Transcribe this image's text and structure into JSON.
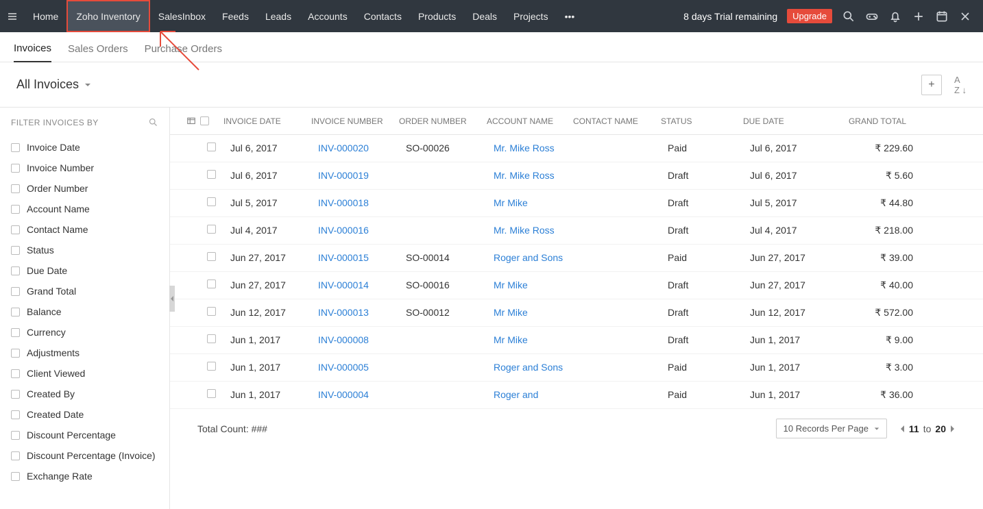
{
  "nav": {
    "items": [
      "Home",
      "Zoho Inventory",
      "SalesInbox",
      "Feeds",
      "Leads",
      "Accounts",
      "Contacts",
      "Products",
      "Deals",
      "Projects"
    ],
    "active_index": 1
  },
  "trial": {
    "text": "8 days Trial remaining",
    "upgrade": "Upgrade"
  },
  "subtabs": {
    "items": [
      "Invoices",
      "Sales Orders",
      "Purchase Orders"
    ],
    "active_index": 0
  },
  "title": "All Invoices",
  "sidebar": {
    "heading": "FILTER INVOICES BY",
    "filters": [
      "Invoice Date",
      "Invoice Number",
      "Order Number",
      "Account Name",
      "Contact Name",
      "Status",
      "Due Date",
      "Grand Total",
      "Balance",
      "Currency",
      "Adjustments",
      "Client Viewed",
      "Created By",
      "Created Date",
      "Discount Percentage",
      "Discount Percentage (Invoice)",
      "Exchange Rate"
    ]
  },
  "table": {
    "headers": [
      "INVOICE DATE",
      "INVOICE NUMBER",
      "ORDER NUMBER",
      "ACCOUNT NAME",
      "CONTACT NAME",
      "STATUS",
      "DUE DATE",
      "GRAND TOTAL"
    ],
    "rows": [
      {
        "date": "Jul 6, 2017",
        "inv": "INV-000020",
        "ord": "SO-00026",
        "acc": "Mr. Mike Ross",
        "con": "",
        "sta": "Paid",
        "due": "Jul 6, 2017",
        "tot": "₹ 229.60"
      },
      {
        "date": "Jul 6, 2017",
        "inv": "INV-000019",
        "ord": "",
        "acc": "Mr. Mike Ross",
        "con": "",
        "sta": "Draft",
        "due": "Jul 6, 2017",
        "tot": "₹ 5.60"
      },
      {
        "date": "Jul 5, 2017",
        "inv": "INV-000018",
        "ord": "",
        "acc": "Mr Mike",
        "con": "",
        "sta": "Draft",
        "due": "Jul 5, 2017",
        "tot": "₹ 44.80"
      },
      {
        "date": "Jul 4, 2017",
        "inv": "INV-000016",
        "ord": "",
        "acc": "Mr. Mike Ross",
        "con": "",
        "sta": "Draft",
        "due": "Jul 4, 2017",
        "tot": "₹ 218.00"
      },
      {
        "date": "Jun 27, 2017",
        "inv": "INV-000015",
        "ord": "SO-00014",
        "acc": "Roger and Sons",
        "con": "",
        "sta": "Paid",
        "due": "Jun 27, 2017",
        "tot": "₹ 39.00"
      },
      {
        "date": "Jun 27, 2017",
        "inv": "INV-000014",
        "ord": "SO-00016",
        "acc": "Mr Mike",
        "con": "",
        "sta": "Draft",
        "due": "Jun 27, 2017",
        "tot": "₹ 40.00"
      },
      {
        "date": "Jun 12, 2017",
        "inv": "INV-000013",
        "ord": "SO-00012",
        "acc": "Mr Mike",
        "con": "",
        "sta": "Draft",
        "due": "Jun 12, 2017",
        "tot": "₹ 572.00"
      },
      {
        "date": "Jun 1, 2017",
        "inv": "INV-000008",
        "ord": "",
        "acc": "Mr Mike",
        "con": "",
        "sta": "Draft",
        "due": "Jun 1, 2017",
        "tot": "₹ 9.00"
      },
      {
        "date": "Jun 1, 2017",
        "inv": "INV-000005",
        "ord": "",
        "acc": "Roger and Sons",
        "con": "",
        "sta": "Paid",
        "due": "Jun 1, 2017",
        "tot": "₹ 3.00"
      },
      {
        "date": "Jun 1, 2017",
        "inv": "INV-000004",
        "ord": "",
        "acc": "Roger and",
        "con": "",
        "sta": "Paid",
        "due": "Jun 1, 2017",
        "tot": "₹ 36.00"
      }
    ]
  },
  "footer": {
    "total_count_label": "Total Count: ###",
    "page_size": "10 Records Per Page",
    "pager_from": "11",
    "pager_to": "20",
    "pager_sep": "to"
  }
}
